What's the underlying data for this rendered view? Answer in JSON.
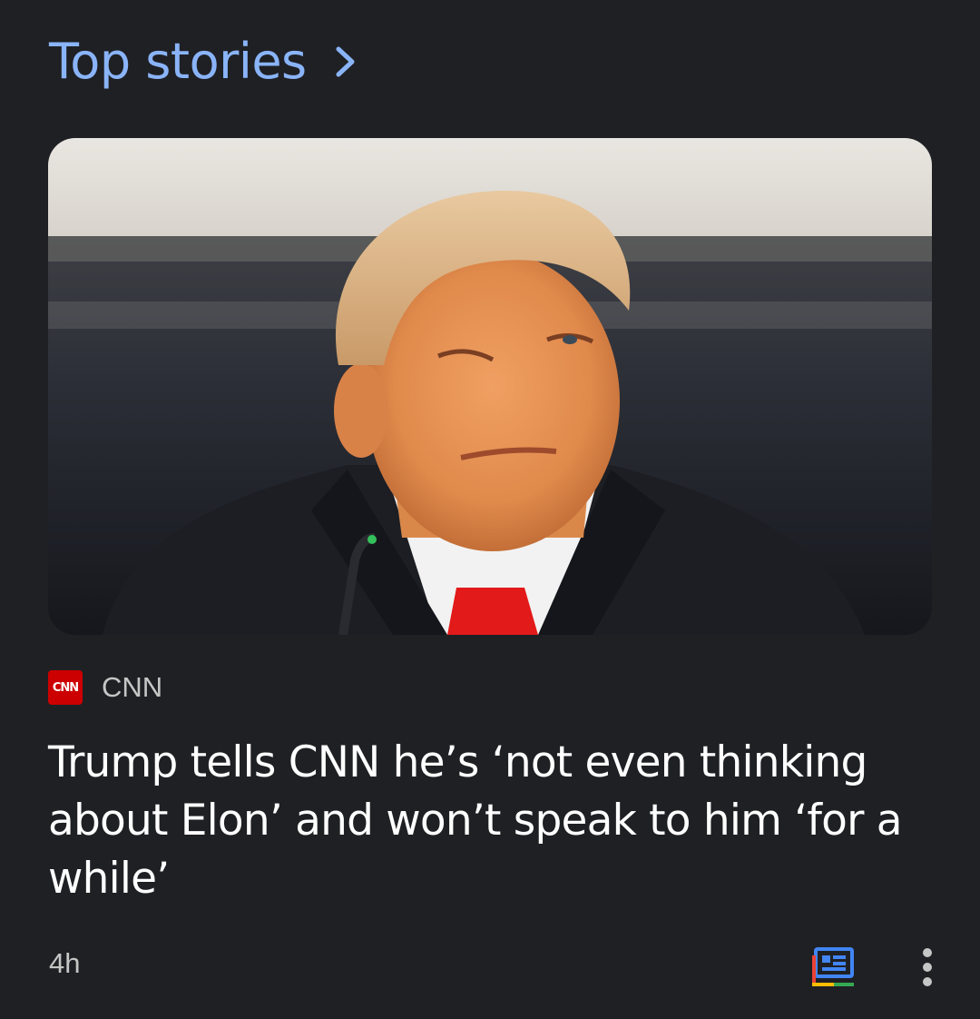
{
  "header": {
    "title": "Top stories",
    "chevron_icon": "chevron-right-icon"
  },
  "story": {
    "image_icon": "news-photo",
    "source": {
      "logo_text": "CNN",
      "name": "CNN",
      "logo_color": "#cc0000"
    },
    "headline": "Trump tells CNN he’s ‘not even thinking about Elon’ and won’t speak to him ‘for a while’",
    "time": "4h",
    "actions": {
      "news_icon": "google-news-icon",
      "more_icon": "more-vert-icon"
    }
  },
  "colors": {
    "background": "#1f2024",
    "accent": "#8ab4f8",
    "secondary_text": "#c4c7c5"
  }
}
